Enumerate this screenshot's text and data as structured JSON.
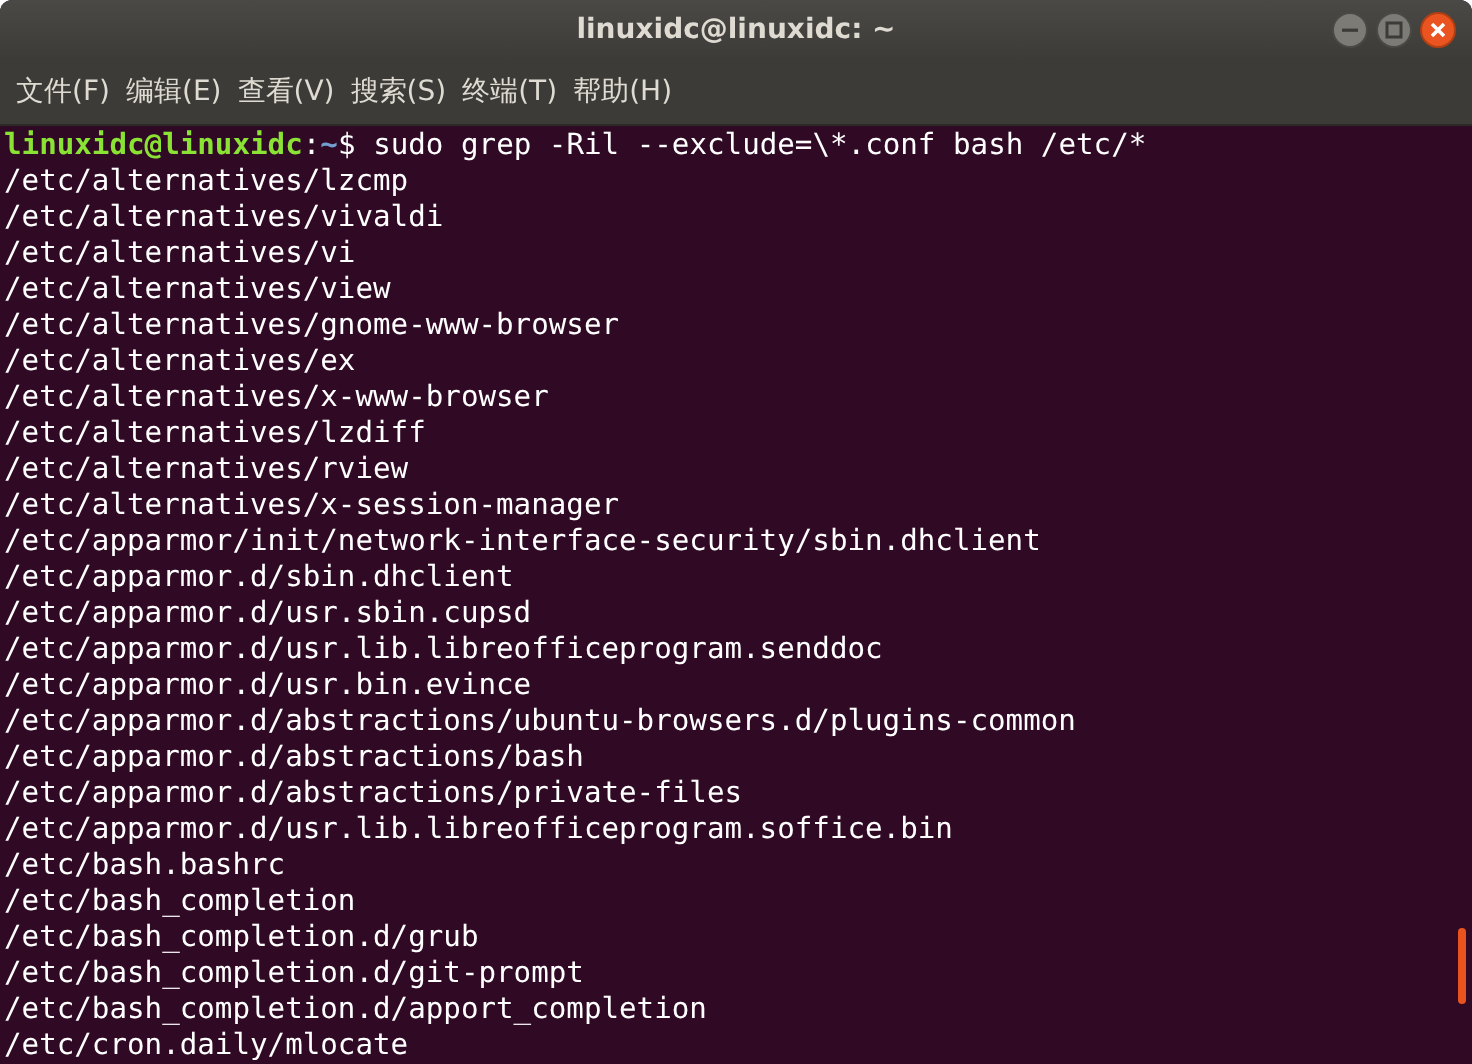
{
  "window": {
    "title": "linuxidc@linuxidc: ~"
  },
  "menu": [
    "文件(F)",
    "编辑(E)",
    "查看(V)",
    "搜索(S)",
    "终端(T)",
    "帮助(H)"
  ],
  "terminal": {
    "prompt": {
      "user_host": "linuxidc@linuxidc",
      "separator": ":",
      "path": "~",
      "symbol": "$",
      "command": "sudo grep -Ril --exclude=\\*.conf bash /etc/*"
    },
    "output": [
      "/etc/alternatives/lzcmp",
      "/etc/alternatives/vivaldi",
      "/etc/alternatives/vi",
      "/etc/alternatives/view",
      "/etc/alternatives/gnome-www-browser",
      "/etc/alternatives/ex",
      "/etc/alternatives/x-www-browser",
      "/etc/alternatives/lzdiff",
      "/etc/alternatives/rview",
      "/etc/alternatives/x-session-manager",
      "/etc/apparmor/init/network-interface-security/sbin.dhclient",
      "/etc/apparmor.d/sbin.dhclient",
      "/etc/apparmor.d/usr.sbin.cupsd",
      "/etc/apparmor.d/usr.lib.libreofficeprogram.senddoc",
      "/etc/apparmor.d/usr.bin.evince",
      "/etc/apparmor.d/abstractions/ubuntu-browsers.d/plugins-common",
      "/etc/apparmor.d/abstractions/bash",
      "/etc/apparmor.d/abstractions/private-files",
      "/etc/apparmor.d/usr.lib.libreofficeprogram.soffice.bin",
      "/etc/bash.bashrc",
      "/etc/bash_completion",
      "/etc/bash_completion.d/grub",
      "/etc/bash_completion.d/git-prompt",
      "/etc/bash_completion.d/apport_completion",
      "/etc/cron.daily/mlocate"
    ]
  }
}
